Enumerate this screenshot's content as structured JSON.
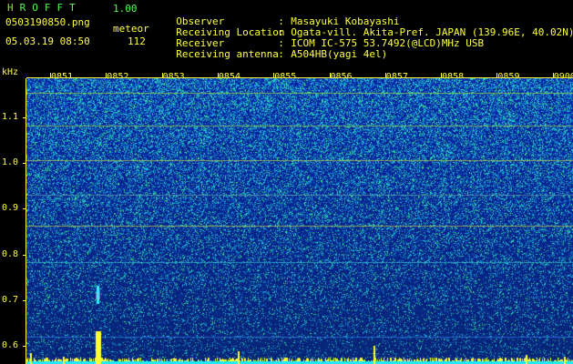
{
  "header": {
    "app_title": "HROFFT",
    "app_version": "1.00",
    "file_name": "0503190850.png",
    "mode_label": "meteor",
    "date_time": "05.03.19 08:50",
    "count_value": "112"
  },
  "info": [
    {
      "key": "Observer",
      "sep": ":",
      "value": "Masayuki Kobayashi"
    },
    {
      "key": "Receiving Location",
      "sep": ":",
      "value": "Ogata-vill. Akita-Pref. JAPAN (139.96E, 40.02N)"
    },
    {
      "key": "Receiver",
      "sep": ":",
      "value": "ICOM IC-575 53.7492(@LCD)MHz USB"
    },
    {
      "key": "Receiving antenna",
      "sep": ":",
      "value": "A504HB(yagi 4el)"
    }
  ],
  "axis": {
    "unit": "kHz",
    "y_ticks": [
      "1.1",
      "1.0",
      "0.9",
      "0.8",
      "0.7",
      "0.6"
    ],
    "x_ticks": [
      "0851",
      "0852",
      "0853",
      "0854",
      "0855",
      "0856",
      "0857",
      "0858",
      "0859",
      "0900"
    ]
  },
  "colors": {
    "text_green": "#4cff4c",
    "text_yellow": "#ffff40",
    "background": "#000000",
    "spectrum_base": "#0a1e9a",
    "spectrum_noise": "#1ec8d8"
  }
}
